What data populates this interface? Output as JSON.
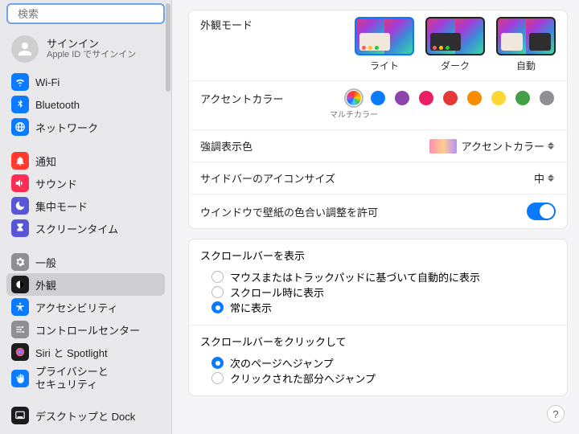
{
  "search": {
    "placeholder": "検索"
  },
  "account": {
    "title": "サインイン",
    "subtitle": "Apple ID でサインイン"
  },
  "sidebar": {
    "items": [
      {
        "label": "Wi-Fi",
        "color": "#0a7aff",
        "icon": "wifi"
      },
      {
        "label": "Bluetooth",
        "color": "#0a7aff",
        "icon": "bluetooth"
      },
      {
        "label": "ネットワーク",
        "color": "#0a7aff",
        "icon": "globe"
      },
      {
        "label": "通知",
        "color": "#ff3b30",
        "icon": "bell"
      },
      {
        "label": "サウンド",
        "color": "#ff2d55",
        "icon": "speaker"
      },
      {
        "label": "集中モード",
        "color": "#5856d6",
        "icon": "moon"
      },
      {
        "label": "スクリーンタイム",
        "color": "#5856d6",
        "icon": "hourglass"
      },
      {
        "label": "一般",
        "color": "#8e8e93",
        "icon": "gear"
      },
      {
        "label": "外観",
        "color": "#1c1c1e",
        "icon": "appearance",
        "selected": true
      },
      {
        "label": "アクセシビリティ",
        "color": "#0a7aff",
        "icon": "accessibility"
      },
      {
        "label": "コントロールセンター",
        "color": "#8e8e93",
        "icon": "sliders"
      },
      {
        "label": "Siri と Spotlight",
        "color": "#1c1c1e",
        "icon": "siri"
      },
      {
        "label": "プライバシーと\nセキュリティ",
        "color": "#0a7aff",
        "icon": "hand"
      },
      {
        "label": "デスクトップと Dock",
        "color": "#1c1c1e",
        "icon": "dock"
      }
    ]
  },
  "appearance": {
    "mode_label": "外観モード",
    "modes": [
      {
        "label": "ライト",
        "selected": true
      },
      {
        "label": "ダーク"
      },
      {
        "label": "自動"
      }
    ],
    "accent_label": "アクセントカラー",
    "accent_colors": [
      {
        "name": "multicolor",
        "hex": "multi",
        "selected": true,
        "caption": "マルチカラー"
      },
      {
        "name": "blue",
        "hex": "#0a7aff"
      },
      {
        "name": "purple",
        "hex": "#8e44ad"
      },
      {
        "name": "pink",
        "hex": "#e91e63"
      },
      {
        "name": "red",
        "hex": "#e53935"
      },
      {
        "name": "orange",
        "hex": "#fb8c00"
      },
      {
        "name": "yellow",
        "hex": "#fdd835"
      },
      {
        "name": "green",
        "hex": "#43a047"
      },
      {
        "name": "graphite",
        "hex": "#8e8e93"
      }
    ],
    "highlight_label": "強調表示色",
    "highlight_value": "アクセントカラー",
    "sidebar_icon_label": "サイドバーのアイコンサイズ",
    "sidebar_icon_value": "中",
    "tint_label": "ウインドウで壁紙の色合い調整を許可",
    "tint_on": true,
    "scroll_show": {
      "title": "スクロールバーを表示",
      "options": [
        {
          "label": "マウスまたはトラックパッドに基づいて自動的に表示",
          "on": false
        },
        {
          "label": "スクロール時に表示",
          "on": false
        },
        {
          "label": "常に表示",
          "on": true
        }
      ]
    },
    "scroll_click": {
      "title": "スクロールバーをクリックして",
      "options": [
        {
          "label": "次のページへジャンプ",
          "on": true
        },
        {
          "label": "クリックされた部分へジャンプ",
          "on": false
        }
      ]
    }
  },
  "help": "?"
}
